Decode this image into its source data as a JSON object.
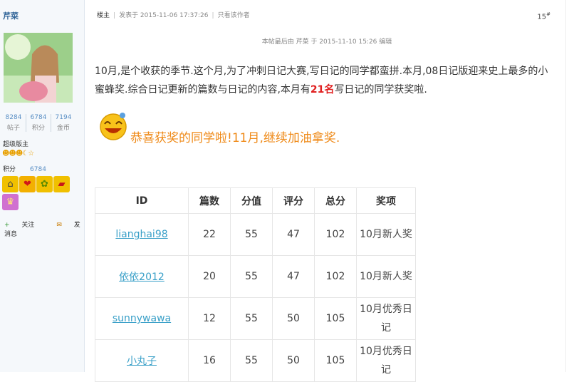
{
  "sidebar": {
    "author": "芹菜",
    "stats": [
      {
        "value": "8284",
        "label": "帖子"
      },
      {
        "value": "6784",
        "label": "积分"
      },
      {
        "value": "7194",
        "label": "金币"
      }
    ],
    "rank": "超级版主",
    "points_label": "积分",
    "points_value": "6784",
    "follow": "关注",
    "message": "发消息"
  },
  "post": {
    "owner_label": "楼主",
    "posted": "发表于 2015-11-06 17:37:26",
    "only_author": "只看该作者",
    "floor": "15",
    "floor_mark": "#",
    "edited": "本帖最后由 芹菜 于 2015-11-10 15:26 编辑",
    "para_part1": "10月,是个收获的季节.这个月,为了冲刺日记大赛,写日记的同学都蛮拼.本月,08日记版迎来史上最多的小蜜蜂奖.综合日记更新的篇数与日记的内容,本月有",
    "para_highlight": "21名",
    "para_part2": "写日记的同学获奖啦.",
    "congrats": "恭喜获奖的同学啦!11月,继续加油拿奖."
  },
  "table": {
    "headers": [
      "ID",
      "篇数",
      "分值",
      "评分",
      "总分",
      "奖项"
    ],
    "rows": [
      {
        "id": "lianghai98",
        "count": "22",
        "score": "55",
        "rating": "47",
        "total": "102",
        "award": "10月新人奖"
      },
      {
        "id": "依依2012",
        "count": "20",
        "score": "55",
        "rating": "47",
        "total": "102",
        "award": "10月新人奖"
      },
      {
        "id": "sunnywawa",
        "count": "12",
        "score": "55",
        "rating": "50",
        "total": "105",
        "award": "10月优秀日记"
      },
      {
        "id": "小丸子",
        "count": "16",
        "score": "55",
        "rating": "50",
        "total": "105",
        "award": "10月优秀日记"
      }
    ]
  },
  "colors": {
    "accent": "#ef8a18",
    "link": "#3aa0c8",
    "highlight": "#e02020"
  },
  "icons": [
    "smiley-icon",
    "home-icon",
    "heart-icon",
    "bee-icon",
    "sofa-icon",
    "crown-icon"
  ]
}
